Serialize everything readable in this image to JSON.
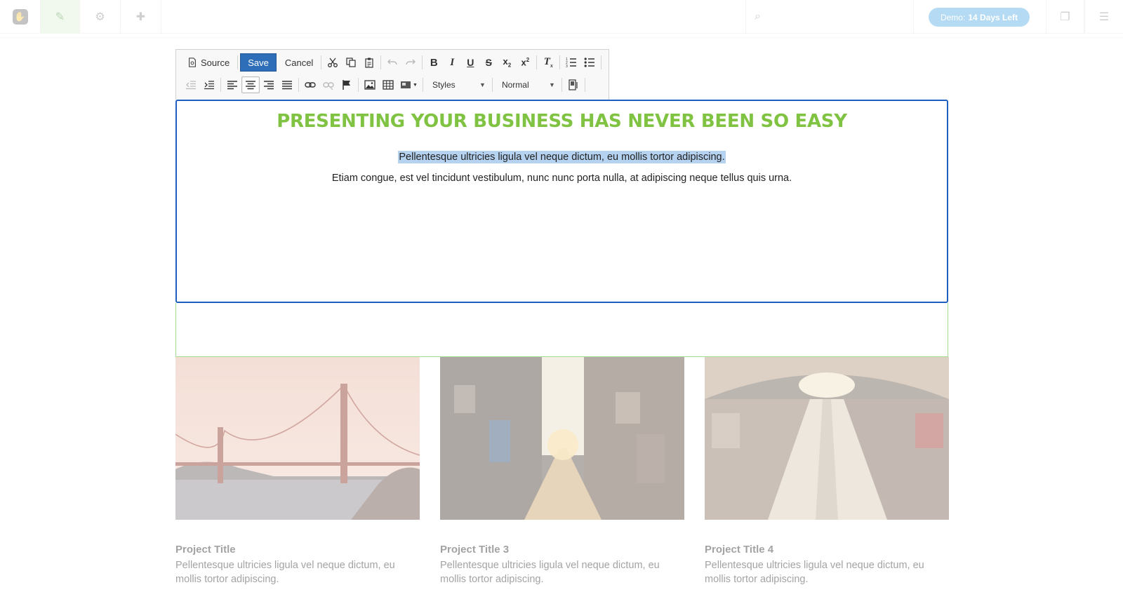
{
  "topbar": {
    "demo_prefix": "Demo:",
    "demo_days": "14 Days Left"
  },
  "toolbar": {
    "source_label": "Source",
    "save_label": "Save",
    "cancel_label": "Cancel",
    "styles_label": "Styles",
    "format_label": "Normal"
  },
  "content": {
    "headline": "PRESENTING YOUR BUSINESS HAS NEVER BEEN SO EASY",
    "paragraph_selected": "Pellentesque ultricies ligula vel neque dictum, eu mollis tortor adipiscing.",
    "paragraph_2": "Etiam congue, est vel tincidunt vestibulum, nunc nunc porta nulla, at adipiscing neque tellus quis urna."
  },
  "projects": [
    {
      "title": "Project Title",
      "desc": "Pellentesque ultricies ligula vel neque dictum, eu mollis tortor adipiscing.",
      "image": "golden-gate-bridge"
    },
    {
      "title": "Project Title 3",
      "desc": "Pellentesque ultricies ligula vel neque dictum, eu mollis tortor adipiscing.",
      "image": "city-street-sunset"
    },
    {
      "title": "Project Title 4",
      "desc": "Pellentesque ultricies ligula vel neque dictum, eu mollis tortor adipiscing.",
      "image": "subway-escalator"
    }
  ],
  "colors": {
    "headline": "#80c342",
    "save_button": "#2e6eb8",
    "edit_border": "#1f5fbf",
    "selection": "#b5d2f0"
  }
}
